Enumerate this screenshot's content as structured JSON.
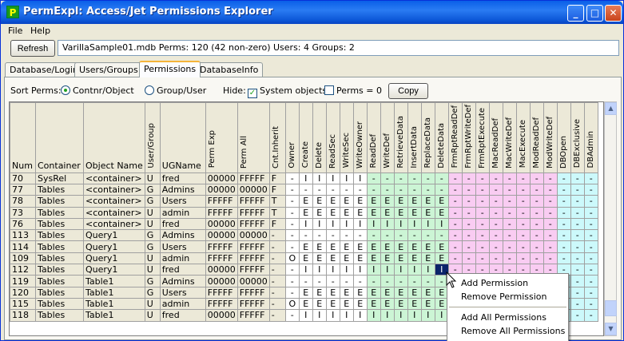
{
  "window": {
    "title": "PermExpl: Access/Jet Permissions Explorer",
    "icon_letter": "P"
  },
  "menu": [
    "File",
    "Help"
  ],
  "toolbar": {
    "refresh": "Refresh",
    "info": "VarillaSample01.mdb   Perms: 120 (42 non-zero)  Users: 4 Groups: 2"
  },
  "tabs": [
    "Database/Login",
    "Users/Groups",
    "Permissions",
    "DatabaseInfo"
  ],
  "options": {
    "sort_label": "Sort Perms:",
    "sort_opt1": "Contnr/Object",
    "sort_opt2": "Group/User",
    "hide_label": "Hide:",
    "hide_sys": "System objects",
    "hide_zero": "Perms = 0",
    "copy": "Copy",
    "check_mark": "✓"
  },
  "grid": {
    "headers": [
      "Num",
      "Container",
      "Object Name",
      "User/Group",
      "UGName",
      "Perm Exp",
      "Perm All",
      "Cnt.Inherit",
      "Owner",
      "Create",
      "Delete",
      "ReadSec",
      "WriteSec",
      "WriteOwner",
      "ReadDef",
      "WriteDef",
      "RetrieveData",
      "InsertData",
      "ReplaceData",
      "DeleteData",
      "FrmRptReadDef",
      "FrmRptWriteDef",
      "FrmRptExecute",
      "MacReadDef",
      "MacWriteDef",
      "MacExecute",
      "ModReadDef",
      "ModWriteDef",
      "DBOpen",
      "DBExclusive",
      "DBAdmin"
    ],
    "rows": [
      [
        "70",
        "SysRel",
        "<container>",
        "U",
        "fred",
        "00000",
        "FFFFF",
        "F",
        "-",
        "I",
        "I",
        "I",
        "I",
        "I",
        "-",
        "-",
        "-",
        "-",
        "-",
        "-",
        "-",
        "-",
        "-",
        "-",
        "-",
        "-",
        "-",
        "-",
        "-",
        "-",
        "-"
      ],
      [
        "77",
        "Tables",
        "<container>",
        "G",
        "Admins",
        "00000",
        "00000",
        "F",
        "-",
        "-",
        "-",
        "-",
        "-",
        "-",
        "-",
        "-",
        "-",
        "-",
        "-",
        "-",
        "-",
        "-",
        "-",
        "-",
        "-",
        "-",
        "-",
        "-",
        "-",
        "-",
        "-"
      ],
      [
        "78",
        "Tables",
        "<container>",
        "G",
        "Users",
        "FFFFF",
        "FFFFF",
        "T",
        "-",
        "E",
        "E",
        "E",
        "E",
        "E",
        "E",
        "E",
        "E",
        "E",
        "E",
        "E",
        "-",
        "-",
        "-",
        "-",
        "-",
        "-",
        "-",
        "-",
        "-",
        "-",
        "-"
      ],
      [
        "73",
        "Tables",
        "<container>",
        "U",
        "admin",
        "FFFFF",
        "FFFFF",
        "T",
        "-",
        "E",
        "E",
        "E",
        "E",
        "E",
        "E",
        "E",
        "E",
        "E",
        "E",
        "E",
        "-",
        "-",
        "-",
        "-",
        "-",
        "-",
        "-",
        "-",
        "-",
        "-",
        "-"
      ],
      [
        "76",
        "Tables",
        "<container>",
        "U",
        "fred",
        "00000",
        "FFFFF",
        "F",
        "-",
        "I",
        "I",
        "I",
        "I",
        "I",
        "I",
        "I",
        "I",
        "I",
        "I",
        "I",
        "-",
        "-",
        "-",
        "-",
        "-",
        "-",
        "-",
        "-",
        "-",
        "-",
        "-"
      ],
      [
        "113",
        "Tables",
        "Query1",
        "G",
        "Admins",
        "00000",
        "00000",
        "-",
        "-",
        "-",
        "-",
        "-",
        "-",
        "-",
        "-",
        "-",
        "-",
        "-",
        "-",
        "-",
        "-",
        "-",
        "-",
        "-",
        "-",
        "-",
        "-",
        "-",
        "-",
        "-",
        "-"
      ],
      [
        "114",
        "Tables",
        "Query1",
        "G",
        "Users",
        "FFFFF",
        "FFFFF",
        "-",
        "-",
        "E",
        "E",
        "E",
        "E",
        "E",
        "E",
        "E",
        "E",
        "E",
        "E",
        "E",
        "-",
        "-",
        "-",
        "-",
        "-",
        "-",
        "-",
        "-",
        "-",
        "-",
        "-"
      ],
      [
        "109",
        "Tables",
        "Query1",
        "U",
        "admin",
        "FFFFF",
        "FFFFF",
        "-",
        "O",
        "E",
        "E",
        "E",
        "E",
        "E",
        "E",
        "E",
        "E",
        "E",
        "E",
        "E",
        "-",
        "-",
        "-",
        "-",
        "-",
        "-",
        "-",
        "-",
        "-",
        "-",
        "-"
      ],
      [
        "112",
        "Tables",
        "Query1",
        "U",
        "fred",
        "00000",
        "FFFFF",
        "-",
        "-",
        "I",
        "I",
        "I",
        "I",
        "I",
        "I",
        "I",
        "I",
        "I",
        "I",
        "I",
        "-",
        "-",
        "-",
        "-",
        "-",
        "-",
        "-",
        "-",
        "-",
        "-",
        "-"
      ],
      [
        "119",
        "Tables",
        "Table1",
        "G",
        "Admins",
        "00000",
        "00000",
        "-",
        "-",
        "-",
        "-",
        "-",
        "-",
        "-",
        "-",
        "-",
        "-",
        "-",
        "-",
        "-",
        "-",
        "-",
        "-",
        "-",
        "-",
        "-",
        "-",
        "-",
        "-",
        "-",
        "-"
      ],
      [
        "120",
        "Tables",
        "Table1",
        "G",
        "Users",
        "FFFFF",
        "FFFFF",
        "-",
        "-",
        "E",
        "E",
        "E",
        "E",
        "E",
        "E",
        "E",
        "E",
        "E",
        "E",
        "E",
        "-",
        "-",
        "-",
        "-",
        "-",
        "-",
        "-",
        "-",
        "-",
        "-",
        "-"
      ],
      [
        "115",
        "Tables",
        "Table1",
        "U",
        "admin",
        "FFFFF",
        "FFFFF",
        "-",
        "O",
        "E",
        "E",
        "E",
        "E",
        "E",
        "E",
        "E",
        "E",
        "E",
        "E",
        "E",
        "-",
        "-",
        "-",
        "-",
        "-",
        "-",
        "-",
        "-",
        "-",
        "-",
        "-"
      ],
      [
        "118",
        "Tables",
        "Table1",
        "U",
        "fred",
        "00000",
        "FFFFF",
        "-",
        "-",
        "I",
        "I",
        "I",
        "I",
        "I",
        "I",
        "I",
        "I",
        "I",
        "I",
        "I",
        "-",
        "-",
        "-",
        "-",
        "-",
        "-",
        "-",
        "-",
        "-",
        "-",
        "-"
      ]
    ]
  },
  "context_menu": [
    "Add Permission",
    "Remove Permission",
    "Add All Permissions",
    "Remove All Permissions"
  ],
  "colors": {
    "green": "#ccf5d5",
    "pink": "#f9ccf2",
    "cyan": "#ccf9fb",
    "selected": "#0a246a"
  }
}
